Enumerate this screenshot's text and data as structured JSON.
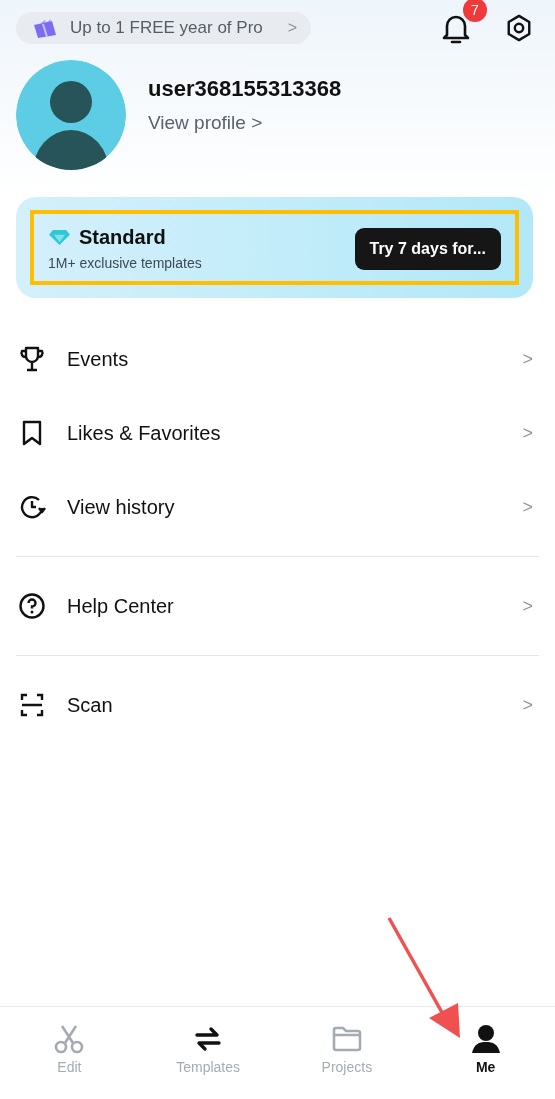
{
  "promo": {
    "text": "Up to 1 FREE year of Pro",
    "chevron": ">"
  },
  "notifications": {
    "badge": "7"
  },
  "profile": {
    "username": "user368155313368",
    "link": "View profile",
    "link_chevron": ">"
  },
  "membership": {
    "title": "Standard",
    "subtitle": "1M+ exclusive templates",
    "button": "Try 7 days for...",
    "highlighted": true
  },
  "menu_groups": [
    [
      {
        "kind": "trophy",
        "label": "Events",
        "chevron": ">"
      },
      {
        "kind": "bookmark",
        "label": "Likes & Favorites",
        "chevron": ">"
      },
      {
        "kind": "history",
        "label": "View history",
        "chevron": ">"
      }
    ],
    [
      {
        "kind": "help",
        "label": "Help Center",
        "chevron": ">"
      }
    ],
    [
      {
        "kind": "scan",
        "label": "Scan",
        "chevron": ">"
      }
    ]
  ],
  "tabs": [
    {
      "kind": "edit",
      "label": "Edit",
      "selected": false
    },
    {
      "kind": "templates",
      "label": "Templates",
      "selected": false
    },
    {
      "kind": "projects",
      "label": "Projects",
      "selected": false
    },
    {
      "kind": "me",
      "label": "Me",
      "selected": true
    }
  ],
  "annotations": [
    {
      "kind": "arrow"
    }
  ]
}
